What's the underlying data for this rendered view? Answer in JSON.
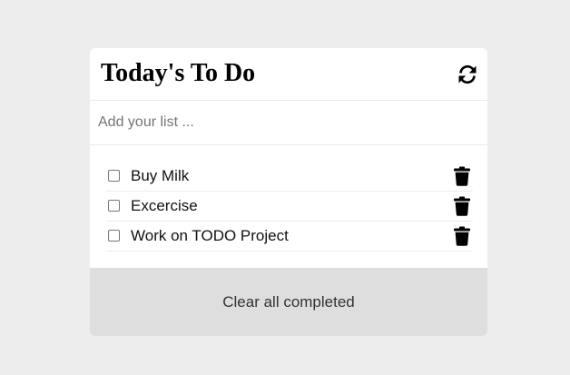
{
  "header": {
    "title": "Today's To Do",
    "refresh_icon": "refresh-icon"
  },
  "add_input": {
    "value": "",
    "placeholder": "Add your list ..."
  },
  "todos": [
    {
      "label": "Buy Milk",
      "checked": false,
      "delete_icon": "trash-icon"
    },
    {
      "label": "Excercise",
      "checked": false,
      "delete_icon": "trash-icon"
    },
    {
      "label": "Work on TODO Project",
      "checked": false,
      "delete_icon": "trash-icon"
    }
  ],
  "footer": {
    "clear_label": "Clear all completed"
  },
  "colors": {
    "page_background": "#ededed",
    "card_background": "#ffffff",
    "footer_background": "#dedede",
    "icon_color": "#000000"
  }
}
